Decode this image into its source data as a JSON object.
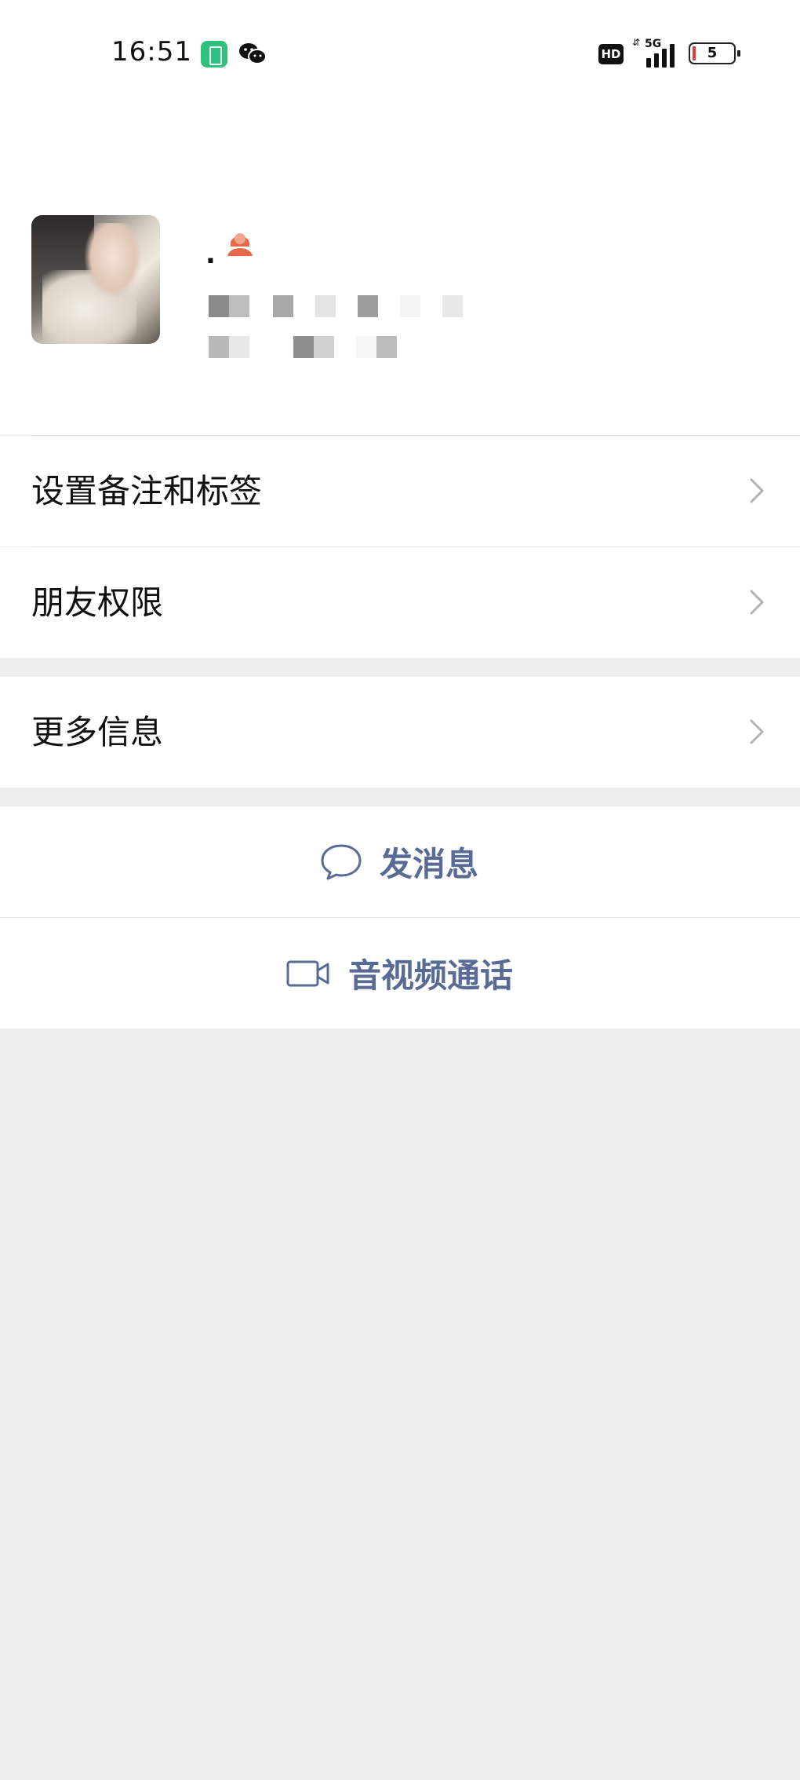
{
  "status_bar": {
    "time": "16:51",
    "network": "5G",
    "hd_badge": "HD",
    "battery_level": "5",
    "icons": [
      "battery-saver-icon",
      "wechat-icon",
      "signal-icon",
      "battery-icon"
    ]
  },
  "nav": {
    "back_icon": "chevron-left-icon",
    "more_icon": "more-dots-icon"
  },
  "profile": {
    "name": ".",
    "gender_icon": "female-user-icon",
    "gender_color": "#e8684a"
  },
  "menu": {
    "items": [
      {
        "label": "设置备注和标签"
      },
      {
        "label": "朋友权限"
      },
      {
        "label": "更多信息"
      }
    ]
  },
  "actions": {
    "send_message": "发消息",
    "av_call": "音视频通话",
    "link_color": "#576b95"
  },
  "colors": {
    "background": "#ededed",
    "card": "#ffffff",
    "status_green": "#2fc27e"
  }
}
